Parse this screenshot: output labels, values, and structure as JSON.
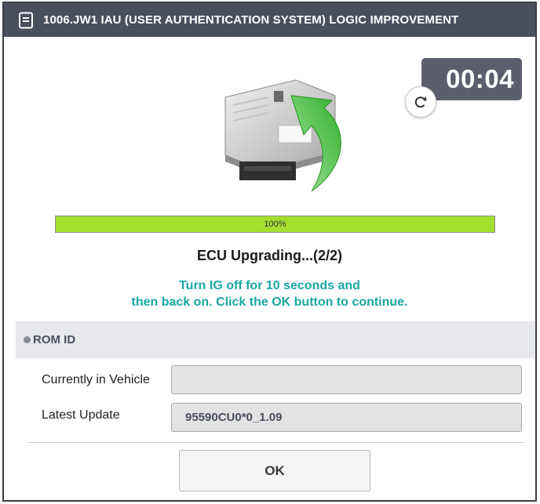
{
  "window": {
    "title": "1006.JW1 IAU (USER AUTHENTICATION SYSTEM) LOGIC IMPROVEMENT",
    "title_icon": "document-icon"
  },
  "timer": {
    "value": "00:04"
  },
  "refresh": {
    "icon": "refresh-icon"
  },
  "progress": {
    "percent": 100,
    "label": "100%"
  },
  "status": {
    "text": "ECU Upgrading...(2/2)"
  },
  "instruction": {
    "line1": "Turn IG off for 10 seconds and",
    "line2": "then back on. Click the OK button to continue."
  },
  "rom_id": {
    "header": "ROM ID",
    "rows": [
      {
        "label": "Currently in Vehicle",
        "value": ""
      },
      {
        "label": "Latest Update",
        "value": "95590CU0*0_1.09"
      }
    ]
  },
  "actions": {
    "ok_label": "OK"
  },
  "colors": {
    "titlebar": "#4a4f5c",
    "progress_fill": "#a3df2f",
    "instruction": "#1aa7a1",
    "arrow": "#3fbf3a"
  }
}
